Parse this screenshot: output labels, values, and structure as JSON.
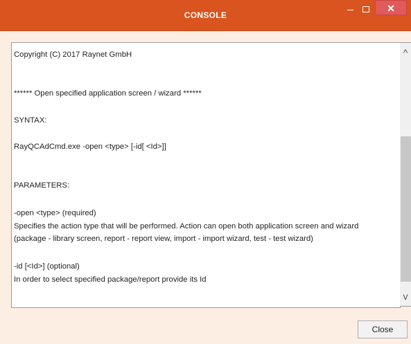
{
  "window": {
    "title": "CONSOLE",
    "minimize_icon": "minimize-icon",
    "maximize_icon": "maximize-icon",
    "close_glyph": "✕"
  },
  "console": {
    "lines": [
      "Copyright (C) 2017 Raynet GmbH",
      "****** Open specified application screen / wizard ******",
      "SYNTAX:",
      "RayQCAdCmd.exe -open <type> [-id[ <Id>]]",
      "PARAMETERS:",
      "-open <type> (required)",
      "Specifies the action type that will be performed. Action can open both application screen and wizard",
      "(package - library screen, report - report view, import - import wizard, test - test wizard)",
      "-id [<Id>] (optional)",
      "In order to select specified package/report provide its Id"
    ]
  },
  "scrollbar": {
    "up_glyph": "^",
    "down_glyph": "v"
  },
  "footer": {
    "close_label": "Close"
  },
  "colors": {
    "titlebar": "#d9541e",
    "background": "#fdeee4",
    "close_button": "#e05a5a"
  }
}
